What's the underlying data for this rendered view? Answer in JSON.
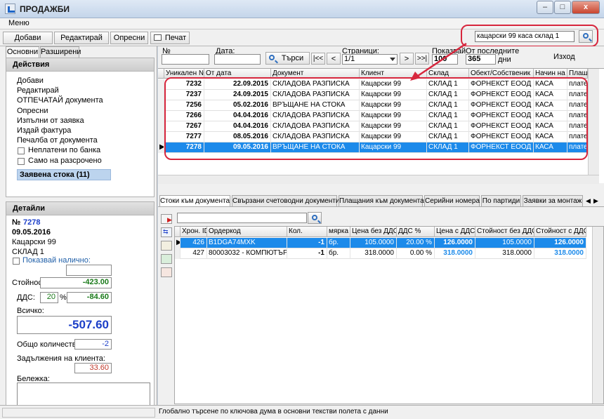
{
  "window": {
    "title": "ПРОДАЖБИ",
    "min": "–",
    "max": "□",
    "close": "x"
  },
  "menu": {
    "label": "Меню"
  },
  "toolbar": {
    "add": "Добави",
    "edit": "Редактирай",
    "refresh": "Опресни",
    "print": "Печат",
    "search_value": "кацарски 99 каса склад 1"
  },
  "left_tabs": [
    "Основни",
    "Разширени"
  ],
  "actions": {
    "title": "Действия",
    "items": [
      "Добави",
      "Редактирай",
      "ОТПЕЧАТАЙ документа",
      "Опресни",
      "Изпълни от заявка",
      "Издай фактура",
      "Печалба от документа"
    ],
    "checkboxes": [
      "Неплатени по банка",
      "Само на разсрочено"
    ],
    "requested": "Заявена стока (11)"
  },
  "details": {
    "title": "Детайли",
    "number_prefix": "№",
    "number": "7278",
    "date": "09.05.2016",
    "client": "Кацарски 99",
    "warehouse": "СКЛАД 1",
    "show_avail": "Показвай налично:",
    "value_label": "Стойност:",
    "value": "-423.00",
    "vat_label": "ДДС:",
    "vat_pct": "20",
    "pct_sign": "%",
    "vat_value": "-84.60",
    "total_label": "Всичко:",
    "total": "-507.60",
    "qty_label": "Общо количество:",
    "qty": "-2",
    "debt_label": "Задължения на клиента:",
    "debt": "33.60",
    "note_label": "Бележка:"
  },
  "filters": {
    "num_label": "№",
    "date_label": "Дата:",
    "search_btn": "Търси",
    "pages_label": "Страници:",
    "pages_value": "1/1",
    "first": "|<<",
    "prev": "<",
    "next": ">",
    "last": ">>|",
    "show_label": "Показвай",
    "show_value": "100",
    "last_label": "От последните",
    "last_value": "365",
    "days": "дни",
    "exit": "Изход"
  },
  "docs": {
    "columns": [
      "Уникален №",
      "От дата",
      "Документ",
      "Клиент",
      "Склад",
      "Обект/Собственик",
      "Начин на",
      "Плащ"
    ],
    "rows": [
      [
        "7232",
        "22.09.2015",
        "СКЛАДОВА РАЗПИСКА",
        "Кацарски 99",
        "СКЛАД 1",
        "ФОРНЕКСТ ЕООД",
        "КАСА",
        "плате"
      ],
      [
        "7237",
        "24.09.2015",
        "СКЛАДОВА РАЗПИСКА",
        "Кацарски 99",
        "СКЛАД 1",
        "ФОРНЕКСТ ЕООД",
        "КАСА",
        "плате"
      ],
      [
        "7256",
        "05.02.2016",
        "ВРЪЩАНЕ НА СТОКА",
        "Кацарски 99",
        "СКЛАД 1",
        "ФОРНЕКСТ ЕООД",
        "КАСА",
        "плате"
      ],
      [
        "7266",
        "04.04.2016",
        "СКЛАДОВА РАЗПИСКА",
        "Кацарски 99",
        "СКЛАД 1",
        "ФОРНЕКСТ ЕООД",
        "КАСА",
        "плате"
      ],
      [
        "7267",
        "04.04.2016",
        "СКЛАДОВА РАЗПИСКА",
        "Кацарски 99",
        "СКЛАД 1",
        "ФОРНЕКСТ ЕООД",
        "КАСА",
        "плате"
      ],
      [
        "7277",
        "08.05.2016",
        "СКЛАДОВА РАЗПИСКА",
        "Кацарски 99",
        "СКЛАД 1",
        "ФОРНЕКСТ ЕООД",
        "КАСА",
        "плате"
      ],
      [
        "7278",
        "09.05.2016",
        "ВРЪЩАНЕ НА СТОКА",
        "Кацарски 99",
        "СКЛАД 1",
        "ФОРНЕКСТ ЕООД",
        "КАСА",
        "плате"
      ]
    ],
    "selected_row": 6
  },
  "bottom_tabs": [
    "Стоки към документа",
    "Свързани счетоводни документи",
    "Плащания към документа",
    "Серийни номера",
    "По партиди",
    "Заявки за монтаж"
  ],
  "items": {
    "columns": [
      "Хрон. ID",
      "Ордеркод",
      "Кол.",
      "мярка",
      "Цена без ДДС",
      "ДДС %",
      "Цена с ДДС",
      "Стойност без ДДС",
      "Стойност с ДДС"
    ],
    "rows": [
      [
        "426",
        "B1DGA74MXK",
        "-1",
        "бр.",
        "105.0000",
        "20.00 %",
        "126.0000",
        "105.0000",
        "126.0000"
      ],
      [
        "427",
        "80003032 - КОМПЮТЪР",
        "-1",
        "бр.",
        "318.0000",
        "0.00 %",
        "318.0000",
        "318.0000",
        "318.0000"
      ]
    ]
  },
  "status": {
    "text": "Глобално търсене по ключова дума в основни текстви полета с данни"
  },
  "colors": {
    "accent": "#1c8aea",
    "annotation": "#d7263d",
    "total_blue": "#1c3fc8",
    "positive_green": "#1a7a1a",
    "debt_red": "#c0392b"
  }
}
